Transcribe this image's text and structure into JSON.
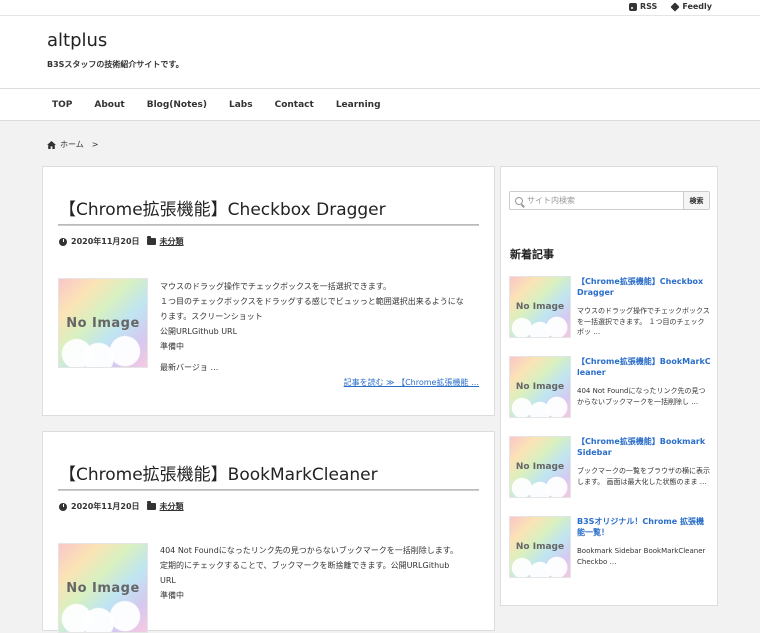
{
  "topbar": {
    "rss_label": "RSS",
    "feedly_label": "Feedly"
  },
  "header": {
    "site_title": "altplus",
    "site_description": "B3Sスタッフの技術紹介サイトです。"
  },
  "nav": {
    "items": [
      "TOP",
      "About",
      "Blog(Notes)",
      "Labs",
      "Contact",
      "Learning"
    ]
  },
  "breadcrumb": {
    "home": "ホーム",
    "separator": ">"
  },
  "posts": [
    {
      "title": "【Chrome拡張機能】Checkbox Dragger",
      "date": "2020年11月20日",
      "category": "未分類",
      "thumb_text": "No Image",
      "excerpt_lines": [
        "マウスのドラッグ操作でチェックボックスを一括選択できます。",
        "１つ目のチェックボックスをドラッグする感じでビュッっと範囲選択出来るようにな",
        "ります。スクリーンショット",
        "公開URLGithub URL",
        "準備中",
        "最新バージョ …"
      ],
      "read_more": "記事を読む ≫ 【Chrome拡張機能 …"
    },
    {
      "title": "【Chrome拡張機能】BookMarkCleaner",
      "date": "2020年11月20日",
      "category": "未分類",
      "thumb_text": "No Image",
      "excerpt_lines": [
        "404 Not Foundになったリンク先の見つからないブックマークを一括削除します。",
        "定期的にチェックすることで、ブックマークを断捨離できます。公開URLGithub",
        "URL",
        "準備中"
      ]
    }
  ],
  "sidebar": {
    "search_placeholder": "サイト内検索",
    "search_button": "検索",
    "recent_heading": "新着記事",
    "recent": [
      {
        "title": "【Chrome拡張機能】Checkbox Dragger",
        "excerpt": "マウスのドラッグ操作でチェックボックスを一括選択できます。 １つ目のチェックボッ …",
        "thumb_text": "No Image"
      },
      {
        "title": "【Chrome拡張機能】BookMarkCleaner",
        "excerpt": "404 Not Foundになったリンク先の見つからないブックマークを一括削除し …",
        "thumb_text": "No Image"
      },
      {
        "title": "【Chrome拡張機能】Bookmark Sidebar",
        "excerpt": "ブックマークの一覧をブラウザの横に表示します。 画面は最大化した状態のまま …",
        "thumb_text": "No Image"
      },
      {
        "title": "B3Sオリジナル！Chrome 拡張機能一覧！",
        "excerpt": "Bookmark Sidebar BookMarkCleaner Checkbo …",
        "thumb_text": "No Image"
      }
    ]
  }
}
